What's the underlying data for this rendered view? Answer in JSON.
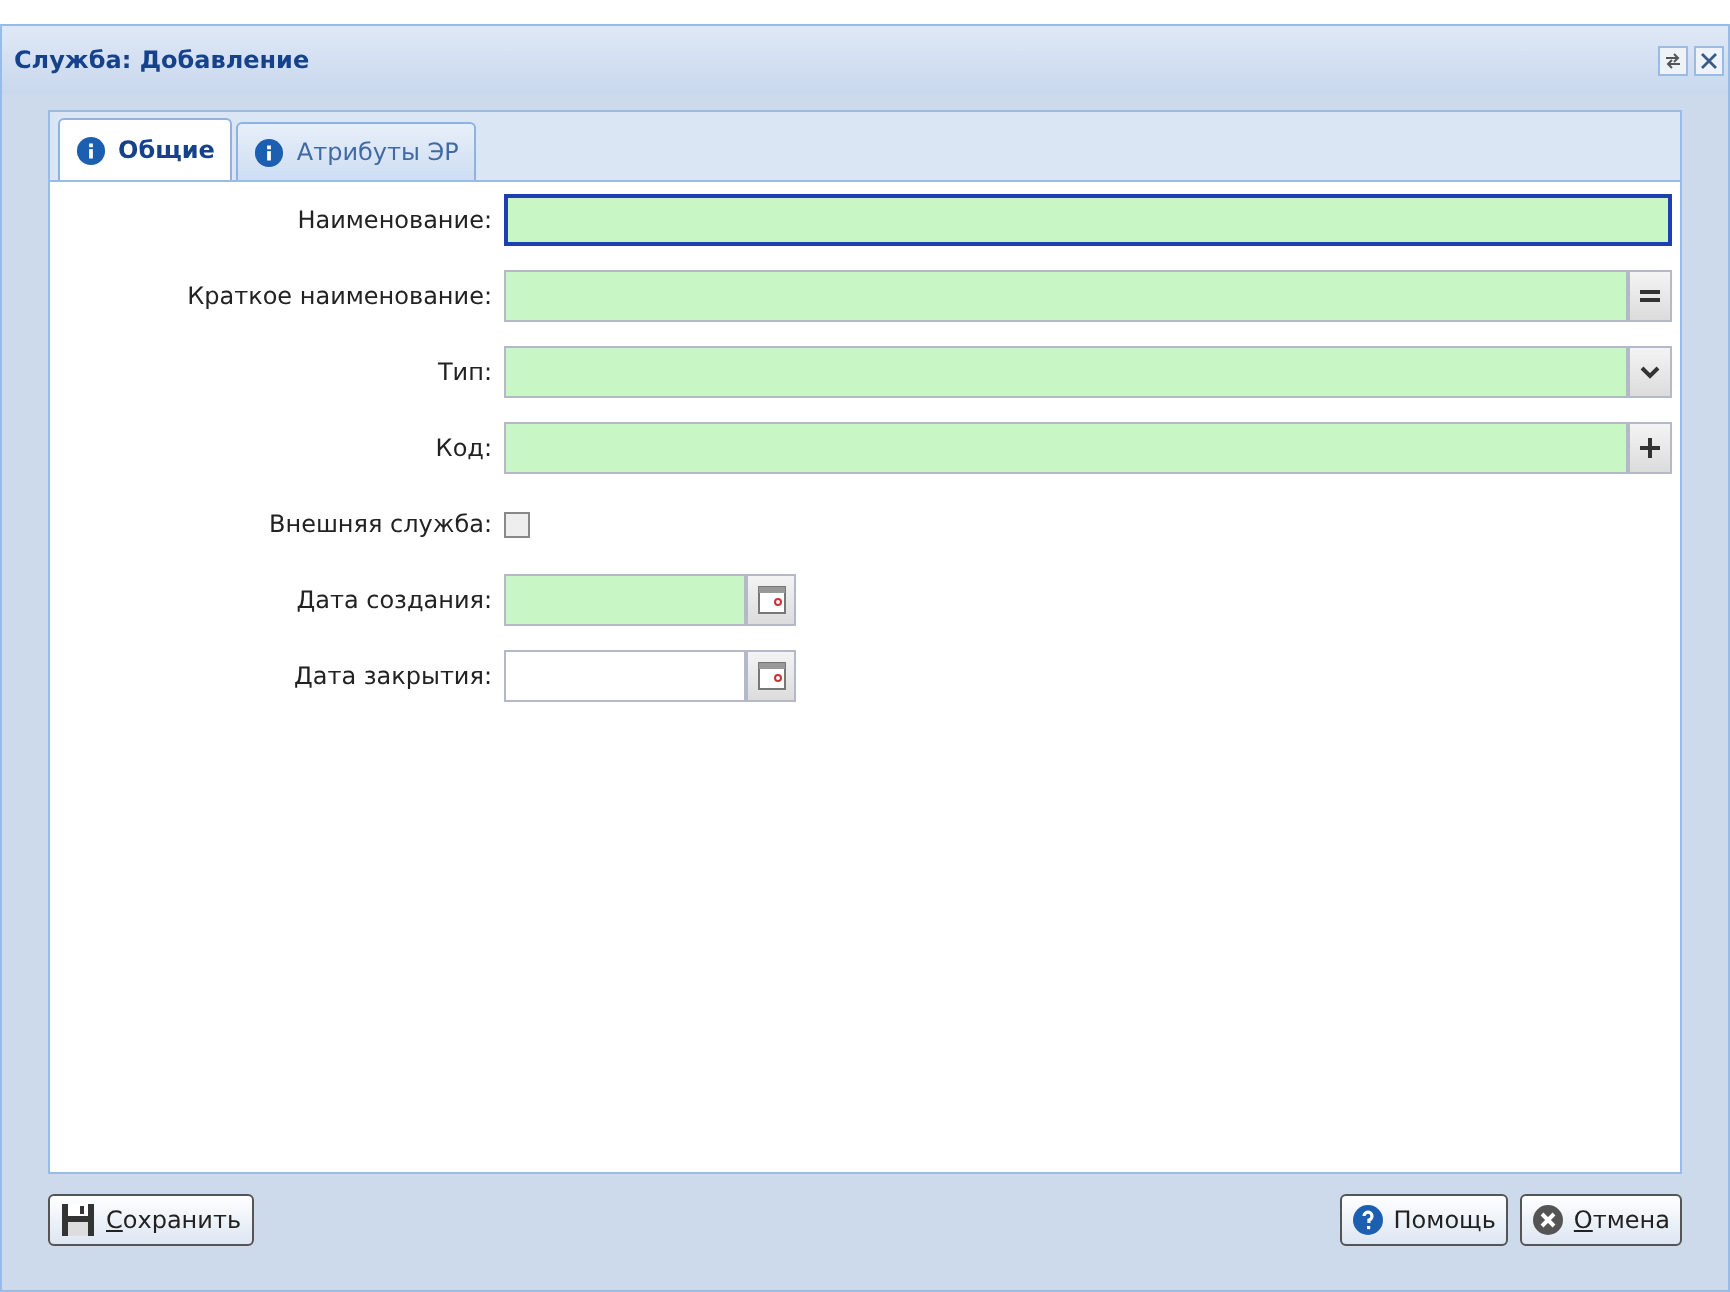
{
  "window": {
    "title": "Служба: Добавление"
  },
  "tabs": [
    {
      "label": "Общие",
      "selected": true
    },
    {
      "label": "Атрибуты ЭР",
      "selected": false
    }
  ],
  "fields": [
    {
      "label": "Наименование:",
      "kind": "text",
      "required": true,
      "focused": true
    },
    {
      "label": "Краткое наименование:",
      "kind": "equals",
      "required": true,
      "focused": false
    },
    {
      "label": "Тип:",
      "kind": "select",
      "required": true,
      "focused": false
    },
    {
      "label": "Код:",
      "kind": "plus",
      "required": true,
      "focused": false
    },
    {
      "label": "Внешняя служба:",
      "kind": "checkbox",
      "checked": false
    },
    {
      "label": "Дата создания:",
      "kind": "date",
      "required": true,
      "focused": false
    },
    {
      "label": "Дата закрытия:",
      "kind": "date",
      "required": false,
      "focused": false
    }
  ],
  "buttons": [
    {
      "label": "Сохранить",
      "kind": "save",
      "mnemonic": true
    },
    {
      "label": "Помощь",
      "kind": "help",
      "mnemonic": false
    },
    {
      "label": "Отмена",
      "kind": "cancel",
      "mnemonic": true
    }
  ]
}
